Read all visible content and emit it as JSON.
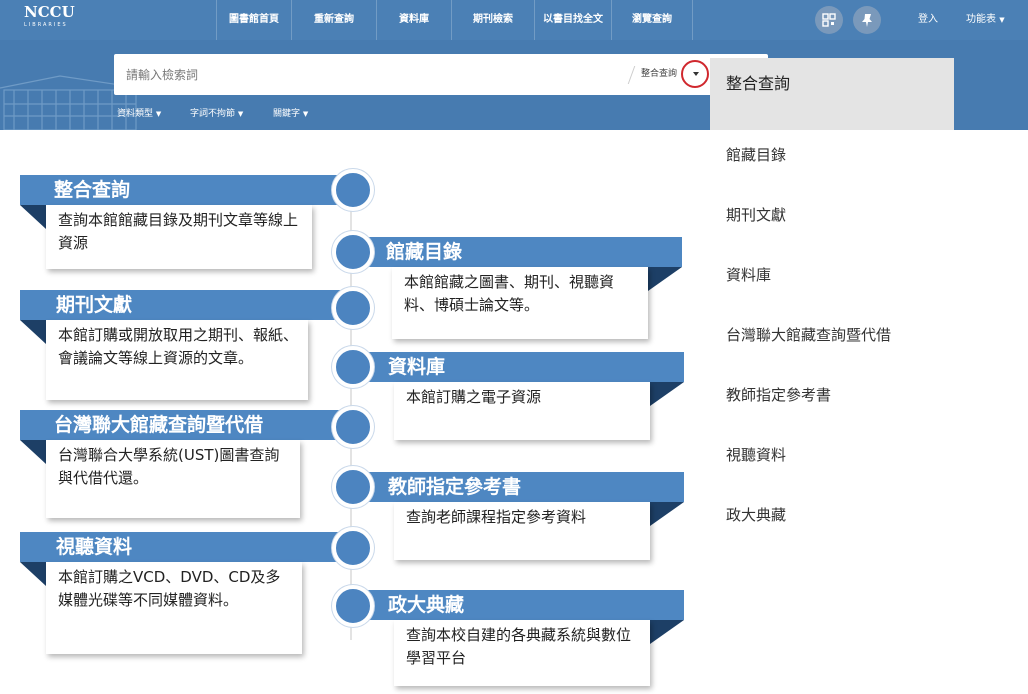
{
  "nav": {
    "logo_main": "NCCU",
    "logo_sub": "LIBRARIES",
    "items": [
      "圖書館首頁",
      "重新查詢",
      "資料庫",
      "期刊檢索",
      "以書目找全文",
      "瀏覽查詢"
    ],
    "qr_icon": "qr-code-icon",
    "pin_icon": "pin-icon",
    "login": "登入",
    "functions": "功能表"
  },
  "search": {
    "placeholder": "請輸入檢索詞",
    "scope_label": "整合查詢",
    "filters": [
      "資料類型",
      "字詞不拘節",
      "關鍵字"
    ]
  },
  "dropdown": {
    "items": [
      "整合查詢",
      "館藏目錄",
      "期刊文獻",
      "資料庫",
      "台灣聯大館藏查詢暨代借",
      "教師指定參考書",
      "視聽資料",
      "政大典藏"
    ],
    "active_index": 0
  },
  "timeline": [
    {
      "title": "整合查詢",
      "desc": "查詢本館館藏目錄及期刊文章等線上資源"
    },
    {
      "title": "館藏目錄",
      "desc": "本館館藏之圖書、期刊、視聽資料、博碩士論文等。"
    },
    {
      "title": "期刊文獻",
      "desc": "本館訂購或開放取用之期刊、報紙、會議論文等線上資源的文章。"
    },
    {
      "title": "資料庫",
      "desc": "本館訂購之電子資源"
    },
    {
      "title": "台灣聯大館藏查詢暨代借",
      "desc": "台灣聯合大學系統(UST)圖書查詢與代借代還。"
    },
    {
      "title": "教師指定參考書",
      "desc": "查詢老師課程指定參考資料"
    },
    {
      "title": "視聽資料",
      "desc": "本館訂購之VCD、DVD、CD及多媒體光碟等不同媒體資料。"
    },
    {
      "title": "政大典藏",
      "desc": "查詢本校自建的各典藏系統與數位學習平台"
    }
  ],
  "colors": {
    "nav_bg": "#4b80b5",
    "ribbon": "#4e87c2",
    "fold": "#1d3f66",
    "highlight_ring": "#d0282e"
  }
}
